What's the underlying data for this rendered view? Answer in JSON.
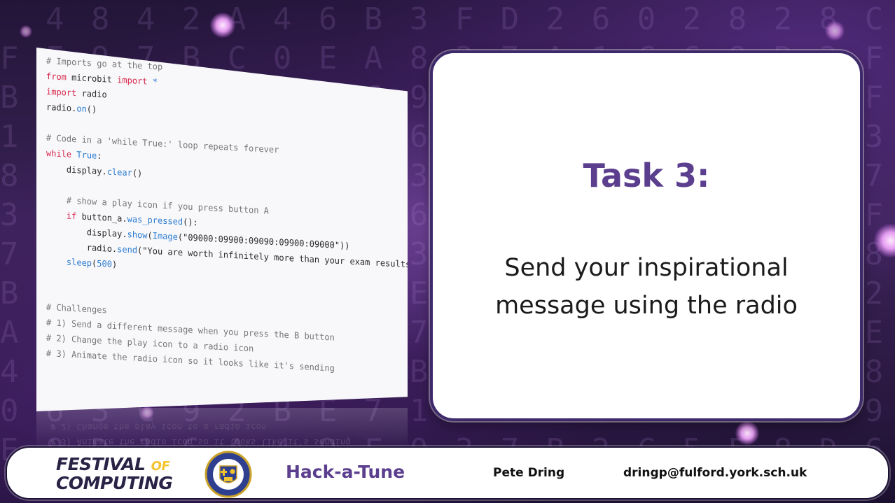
{
  "slide": {
    "background": "purple-bokeh-hex-code",
    "accent_color": "#5b3e8e"
  },
  "code": {
    "lines": [
      "# Imports go at the top",
      "from microbit import *",
      "import radio",
      "radio.on()",
      "",
      "# Code in a 'while True:' loop repeats forever",
      "while True:",
      "    display.clear()",
      "",
      "    # show a play icon if you press button A",
      "    if button_a.was_pressed():",
      "        display.show(Image(\"09000:09900:09090:09900:09000\"))",
      "        radio.send(\"You are worth infinitely more than your exam results\")",
      "    sleep(500)",
      "",
      "",
      "# Challenges",
      "# 1) Send a different message when you press the B button",
      "# 2) Change the play icon to a radio icon",
      "# 3) Animate the radio icon so it looks like it's sending"
    ]
  },
  "task": {
    "title": "Task 3:",
    "body": "Send your inspirational message using the radio"
  },
  "footer": {
    "logo_line1": "FESTIVAL",
    "logo_of": "OF",
    "logo_line2": "COMPUTING",
    "crest_icon": "school-crest-icon",
    "event_name": "Hack-a-Tune",
    "presenter": "Pete Dring",
    "email": "dringp@fulford.york.sch.uk"
  }
}
